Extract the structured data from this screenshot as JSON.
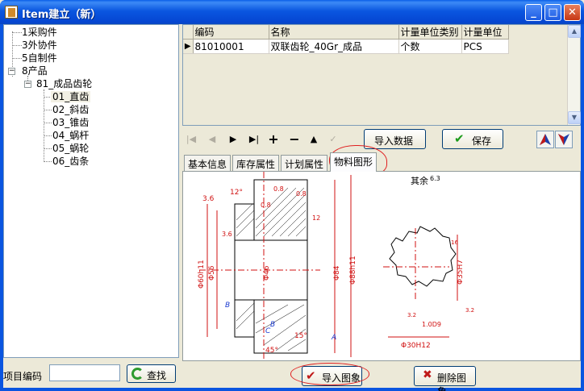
{
  "window": {
    "title": "Item建立（新）"
  },
  "tree": {
    "nodes": [
      {
        "label": "1采购件"
      },
      {
        "label": "3外协件"
      },
      {
        "label": "5自制件"
      },
      {
        "label": "8产品"
      },
      {
        "label": "81_成品齿轮"
      },
      {
        "label": "01_直齿"
      },
      {
        "label": "02_斜齿"
      },
      {
        "label": "03_锥齿"
      },
      {
        "label": "04_蜗杆"
      },
      {
        "label": "05_蜗轮"
      },
      {
        "label": "06_齿条"
      }
    ]
  },
  "search": {
    "label": "项目编码",
    "value": "",
    "button": "查找"
  },
  "grid": {
    "columns": [
      "编码",
      "名称",
      "计量单位类别",
      "计量单位"
    ],
    "rows": [
      [
        "81010001",
        "双联齿轮_40Gr_成品",
        "个数",
        "PCS"
      ]
    ]
  },
  "toolbar": {
    "import_data": "导入数据",
    "save": "保存"
  },
  "tabs": [
    "基本信息",
    "库存属性",
    "计划属性",
    "物料图形"
  ],
  "drawing": {
    "labels": {
      "roughness_note": "其余",
      "roughness_val": "6.3",
      "d60": "Φ60h11",
      "d56": "Φ56",
      "d46": "Φ46",
      "d84": "Φ84",
      "d88": "Φ88h11",
      "d35": "Φ35H7",
      "d30": "Φ30H12",
      "r36a": "3.6",
      "r36b": "3.6",
      "r08a": "0.8",
      "r08b": "0.8",
      "r08c": "0.8",
      "r12a": "12",
      "ang12": "12°",
      "ang15": "15°",
      "ang45": "45°",
      "b1": "B",
      "b2": "B",
      "c": "C",
      "a": "A",
      "dim32": "3.2",
      "dim1009": "1.0D9",
      "r16": "16",
      "r32b": "3.2"
    }
  },
  "bottom": {
    "import_image": "导入图象",
    "delete_image": "删除图象"
  }
}
